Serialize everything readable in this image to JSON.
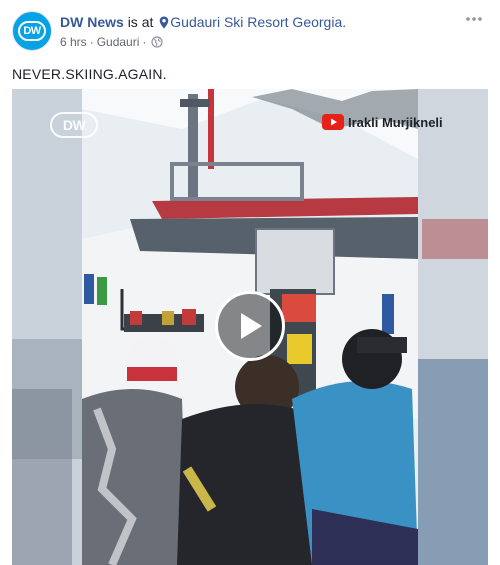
{
  "post": {
    "author": "DW News",
    "is_at": "is at",
    "place": "Gudauri Ski Resort Georgia.",
    "time": "6 hrs",
    "location": "Gudauri",
    "separator": "·",
    "text": "NEVER.SKIING.AGAIN.",
    "avatar_label": "DW"
  },
  "video": {
    "channel_logo": "DW",
    "watermark": "Irakli Murjikneli",
    "play_icon": "play-icon"
  },
  "icons": {
    "pin": "location-pin-icon",
    "globe": "globe-icon",
    "more": "more-options-icon"
  },
  "colors": {
    "link": "#385898",
    "brand": "#05a2e6",
    "meta": "#616770"
  }
}
